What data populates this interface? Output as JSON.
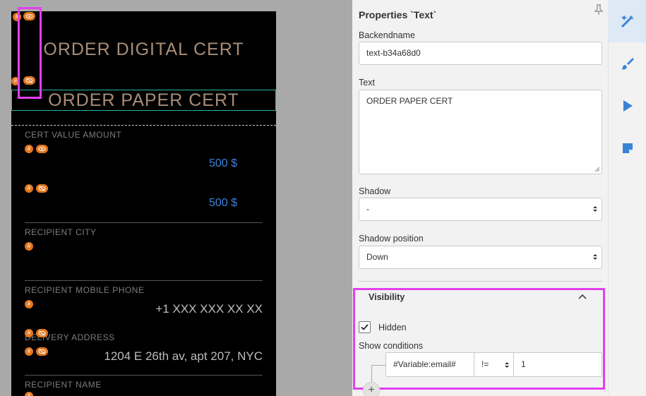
{
  "canvas": {
    "digital_title": "ORDER DIGITAL CERT",
    "paper_title": "ORDER PAPER CERT",
    "cert_value_label": "CERT VALUE AMOUNT",
    "value_1": "500 $",
    "value_2": "500 $",
    "city_label": "RECIPIENT CITY",
    "phone_label": "RECIPIENT MOBILE PHONE",
    "phone_value": "+1 XXX XXX XX XX",
    "address_label": "DELIVERY ADDRESS",
    "address_value": "1204 E 26th av, apt 207, NYC",
    "name_label": "RECIPIENT NAME",
    "badge_symbol": "#"
  },
  "panel": {
    "title": "Properties `Text`",
    "backendname_label": "Backendname",
    "backendname_value": "text-b34a68d0",
    "text_label": "Text",
    "text_value": "ORDER PAPER CERT",
    "shadow_label": "Shadow",
    "shadow_value": "-",
    "shadow_position_label": "Shadow position",
    "shadow_position_value": "Down",
    "visibility_title": "Visibility",
    "hidden_label": "Hidden",
    "hidden_checked": true,
    "show_conditions_label": "Show conditions",
    "condition_variable": "#Variable:email#",
    "condition_operator": "!=",
    "condition_value": "1",
    "add_symbol": "+"
  },
  "tools": {
    "items": [
      "magic-wand-icon",
      "brush-icon",
      "play-icon",
      "note-icon"
    ],
    "active": "magic-wand-icon"
  },
  "colors": {
    "badge": "#e5771e",
    "accent": "#3a82d6",
    "highlight": "#e23ff0",
    "selection": "#2bb5a7",
    "title_text": "#a88d78"
  }
}
